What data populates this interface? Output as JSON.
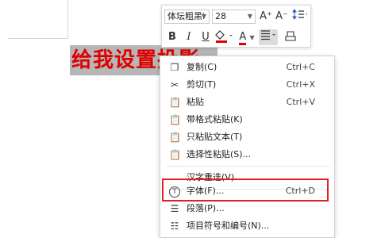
{
  "document": {
    "selected_text": "给我设置投影"
  },
  "toolbar": {
    "font_name": "体坛粗黑i",
    "font_size": "28",
    "grow_label": "A⁺",
    "shrink_label": "A⁻",
    "bold": "B",
    "italic": "I",
    "underline": "U",
    "font_color": "A",
    "highlight_color": "#e00000"
  },
  "context_menu": {
    "items": [
      {
        "label": "复制(C)",
        "shortcut": "Ctrl+C",
        "icon": "copy-icon"
      },
      {
        "label": "剪切(T)",
        "shortcut": "Ctrl+X",
        "icon": "scissors-icon"
      },
      {
        "label": "粘贴",
        "shortcut": "Ctrl+V",
        "icon": "paste-icon"
      },
      {
        "label": "带格式粘贴(K)",
        "shortcut": "",
        "icon": "paste-formatted-icon"
      },
      {
        "label": "只粘贴文本(T)",
        "shortcut": "",
        "icon": "paste-text-icon"
      },
      {
        "label": "选择性粘贴(S)...",
        "shortcut": "",
        "icon": "paste-special-icon"
      },
      {
        "label": "汉字重选(V)",
        "shortcut": "",
        "icon": ""
      },
      {
        "label": "字体(F)...",
        "shortcut": "Ctrl+D",
        "icon": "font-icon"
      },
      {
        "label": "段落(P)...",
        "shortcut": "",
        "icon": "paragraph-icon"
      },
      {
        "label": "项目符号和编号(N)...",
        "shortcut": "",
        "icon": "bullets-icon"
      }
    ]
  },
  "colors": {
    "accent_red": "#e31e24",
    "selection_gray": "#b6b6b6"
  }
}
